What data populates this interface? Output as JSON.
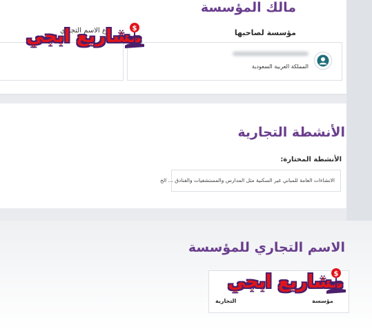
{
  "owner_section": {
    "title": "مالك المؤسسة",
    "owner_type": "مؤسسة لصاحبها",
    "owner_country": "المملكة العربية السعودية",
    "trade_type_label": "نوع الاسم التجاري"
  },
  "activities_section": {
    "title": "الأنشطة التجارية",
    "selected_label": "الأنشطة المختارة:",
    "selected_text": "الانشاءات العامة للمباني غير السكنية مثل المدارس والمستشفيات والفنادق ... الخ"
  },
  "trade_name_section": {
    "title": "الاسم التجاري للمؤسسة",
    "institution_word": "مؤسسة",
    "trade_word": "التجارية"
  },
  "watermark": {
    "text": "مشاريع ابجي",
    "icon": "money-plant-hand-icon",
    "color": "#e0151b",
    "outline_color": "#4a1f6b"
  },
  "colors": {
    "title_purple": "#6a3e8e",
    "avatar_teal": "#1f6f7a"
  }
}
